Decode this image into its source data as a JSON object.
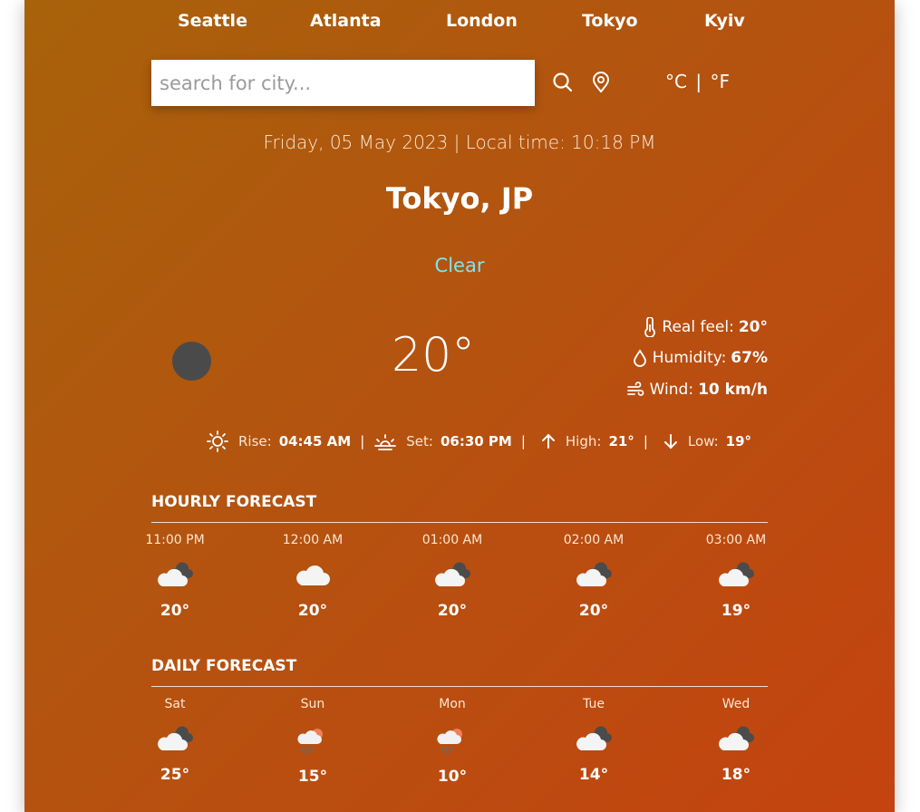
{
  "top_cities": [
    "Seattle",
    "Atlanta",
    "London",
    "Tokyo",
    "Kyiv"
  ],
  "search": {
    "placeholder": "search for city..."
  },
  "units": {
    "celsius": "°C",
    "separator": "|",
    "fahrenheit": "°F"
  },
  "datetime": "Friday, 05 May 2023 | Local time: 10:18 PM",
  "location": "Tokyo, JP",
  "condition": "Clear",
  "current": {
    "temperature": "20°",
    "real_feel_label": "Real feel:",
    "real_feel_value": "20°",
    "humidity_label": "Humidity:",
    "humidity_value": "67%",
    "wind_label": "Wind:",
    "wind_value": "10 km/h"
  },
  "sun": {
    "rise_label": "Rise:",
    "rise_value": "04:45 AM",
    "set_label": "Set:",
    "set_value": "06:30 PM",
    "high_label": "High:",
    "high_value": "21°",
    "low_label": "Low:",
    "low_value": "19°",
    "separator": "|"
  },
  "hourly": {
    "title": "HOURLY FORECAST",
    "items": [
      {
        "label": "11:00 PM",
        "temp": "20°",
        "icon": "cloud-dark-icon"
      },
      {
        "label": "12:00 AM",
        "temp": "20°",
        "icon": "cloud-icon"
      },
      {
        "label": "01:00 AM",
        "temp": "20°",
        "icon": "cloud-dark-icon"
      },
      {
        "label": "02:00 AM",
        "temp": "20°",
        "icon": "cloud-dark-icon"
      },
      {
        "label": "03:00 AM",
        "temp": "19°",
        "icon": "cloud-dark-icon"
      }
    ]
  },
  "daily": {
    "title": "DAILY FORECAST",
    "items": [
      {
        "label": "Sat",
        "temp": "25°",
        "icon": "cloud-dark-icon"
      },
      {
        "label": "Sun",
        "temp": "15°",
        "icon": "rain-sun-icon"
      },
      {
        "label": "Mon",
        "temp": "10°",
        "icon": "rain-sun-icon"
      },
      {
        "label": "Tue",
        "temp": "14°",
        "icon": "cloud-dark-icon"
      },
      {
        "label": "Wed",
        "temp": "18°",
        "icon": "cloud-dark-icon"
      }
    ]
  },
  "colors": {
    "gradient_start": "#a8620a",
    "gradient_end": "#c4430f",
    "condition_text": "#7fe3f0",
    "weather_icon_placeholder": "#4a4a4a"
  }
}
